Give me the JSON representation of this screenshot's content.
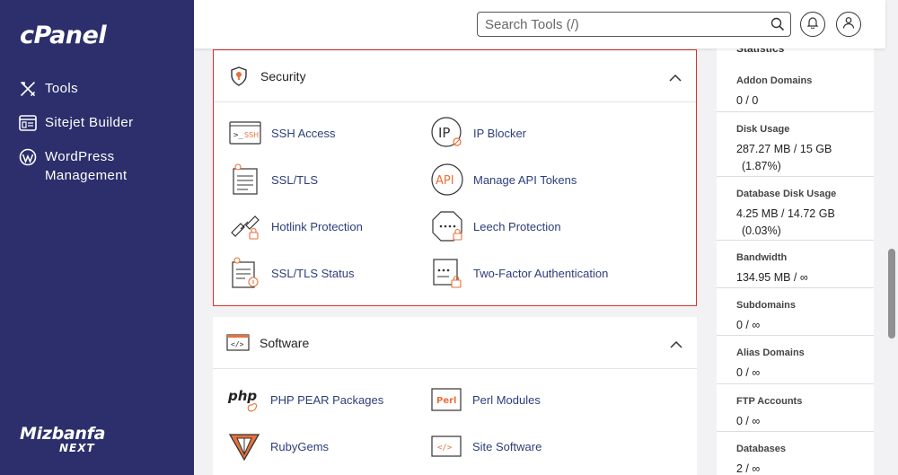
{
  "brand": {
    "logo": "cPanel",
    "footer_line1": "Mizbanfa",
    "footer_line2": "NEXT"
  },
  "sidebar": {
    "items": [
      {
        "label": "Tools",
        "icon": "tools-icon"
      },
      {
        "label": "Sitejet Builder",
        "icon": "sitejet-icon"
      },
      {
        "label": "WordPress Management",
        "icon": "wordpress-icon"
      }
    ]
  },
  "header": {
    "search_placeholder": "Search Tools (/)"
  },
  "security": {
    "title": "Security",
    "tools": [
      {
        "label": "SSH Access",
        "icon": "ssh-icon"
      },
      {
        "label": "IP Blocker",
        "icon": "ip-blocker-icon"
      },
      {
        "label": "SSL/TLS",
        "icon": "ssl-tls-icon"
      },
      {
        "label": "Manage API Tokens",
        "icon": "api-icon"
      },
      {
        "label": "Hotlink Protection",
        "icon": "hotlink-icon"
      },
      {
        "label": "Leech Protection",
        "icon": "leech-icon"
      },
      {
        "label": "SSL/TLS Status",
        "icon": "ssl-status-icon"
      },
      {
        "label": "Two-Factor Authentication",
        "icon": "two-factor-icon"
      }
    ]
  },
  "software": {
    "title": "Software",
    "tools": [
      {
        "label": "PHP PEAR Packages",
        "icon": "php-icon"
      },
      {
        "label": "Perl Modules",
        "icon": "perl-icon"
      },
      {
        "label": "RubyGems",
        "icon": "ruby-icon"
      },
      {
        "label": "Site Software",
        "icon": "site-software-icon"
      }
    ]
  },
  "statistics": {
    "title": "Statistics",
    "items": [
      {
        "label": "Addon Domains",
        "value": "0 / 0",
        "extra": ""
      },
      {
        "label": "Disk Usage",
        "value": "287.27 MB / 15 GB",
        "extra": "(1.87%)"
      },
      {
        "label": "Database Disk Usage",
        "value": "4.25 MB / 14.72 GB",
        "extra": "(0.03%)"
      },
      {
        "label": "Bandwidth",
        "value": "134.95 MB / ∞",
        "extra": ""
      },
      {
        "label": "Subdomains",
        "value": "0 / ∞",
        "extra": ""
      },
      {
        "label": "Alias Domains",
        "value": "0 / ∞",
        "extra": ""
      },
      {
        "label": "FTP Accounts",
        "value": "0 / ∞",
        "extra": ""
      },
      {
        "label": "Databases",
        "value": "2 / ∞",
        "extra": ""
      }
    ]
  },
  "colors": {
    "sidebar": "#2c2f6b",
    "accent": "#e8713a",
    "link": "#2c3e7a",
    "highlight_border": "#d9302c"
  }
}
